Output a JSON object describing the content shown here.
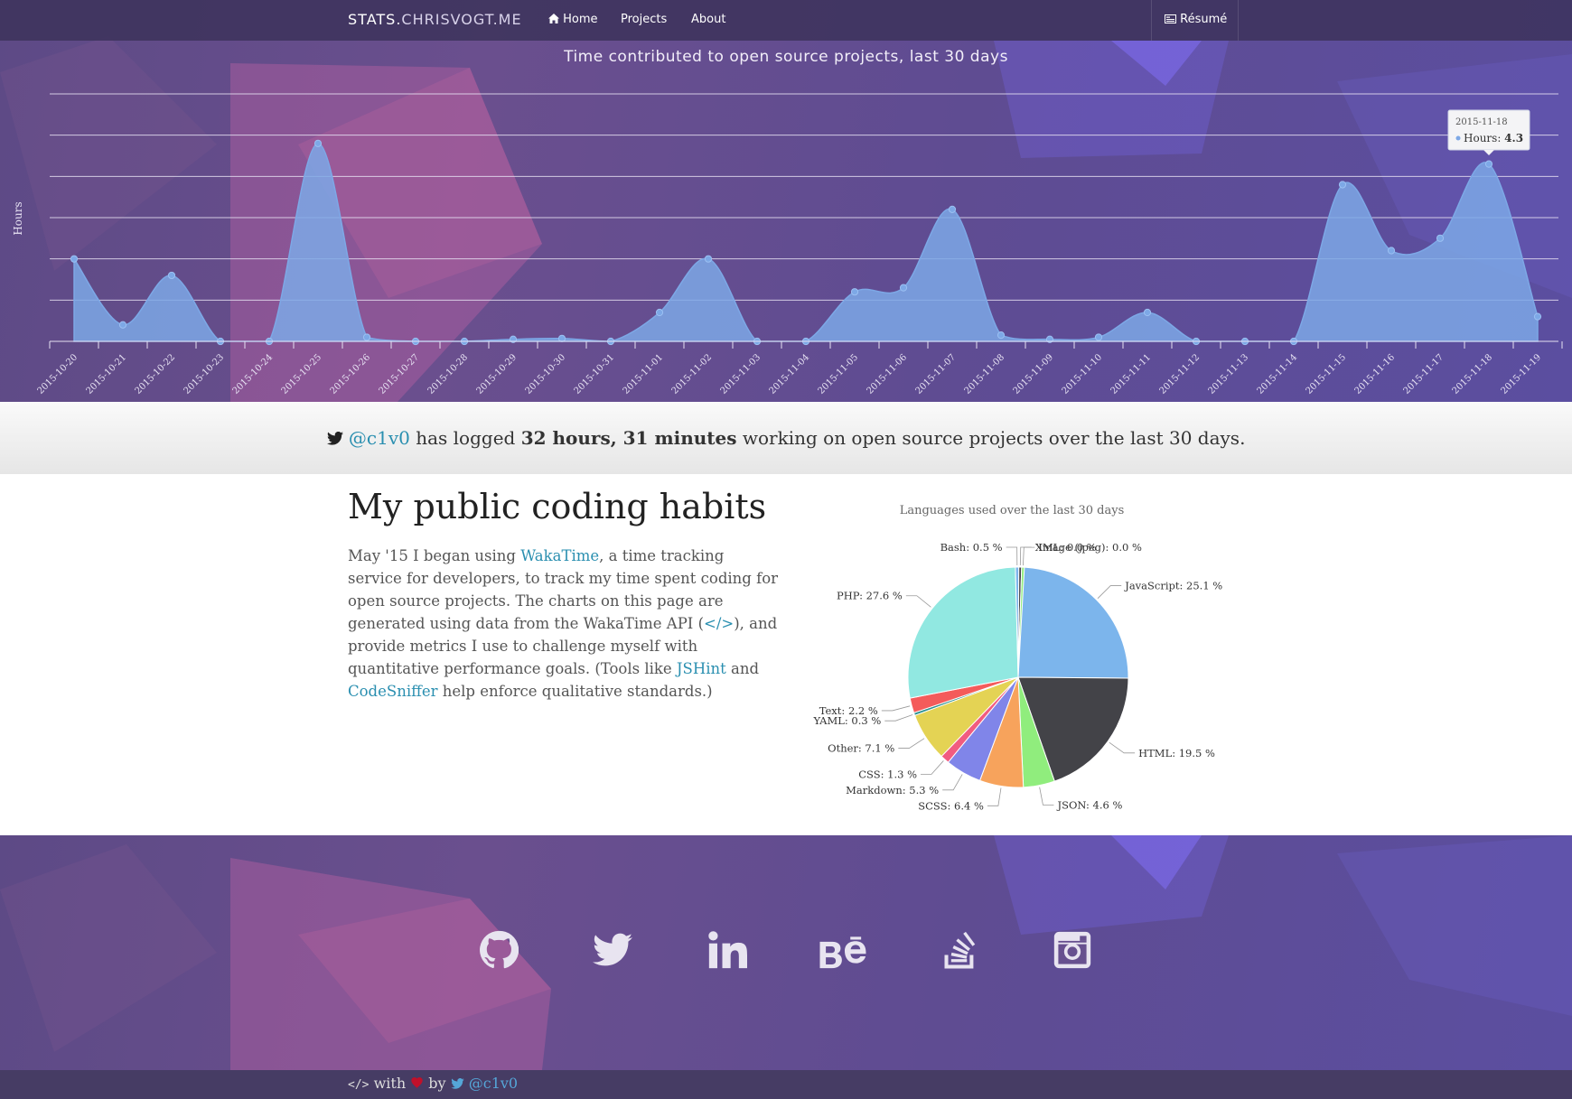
{
  "navbar": {
    "brand_bold": "STATS.",
    "brand_light": "CHRISVOGT.ME",
    "items": [
      {
        "label": "Home",
        "icon": "home-icon"
      },
      {
        "label": "Projects"
      },
      {
        "label": "About"
      }
    ],
    "resume_label": "Résumé",
    "resume_icon": "card-icon"
  },
  "chart_data": [
    {
      "type": "area",
      "title": "Time contributed to open source projects, last 30 days",
      "ylabel": "Hours",
      "x": [
        "2015-10-20",
        "2015-10-21",
        "2015-10-22",
        "2015-10-23",
        "2015-10-24",
        "2015-10-25",
        "2015-10-26",
        "2015-10-27",
        "2015-10-28",
        "2015-10-29",
        "2015-10-30",
        "2015-10-31",
        "2015-11-01",
        "2015-11-02",
        "2015-11-03",
        "2015-11-04",
        "2015-11-05",
        "2015-11-06",
        "2015-11-07",
        "2015-11-08",
        "2015-11-09",
        "2015-11-10",
        "2015-11-11",
        "2015-11-12",
        "2015-11-13",
        "2015-11-14",
        "2015-11-15",
        "2015-11-16",
        "2015-11-17",
        "2015-11-18",
        "2015-11-19"
      ],
      "series": [
        {
          "name": "Hours",
          "values": [
            2.0,
            0.4,
            1.6,
            0.0,
            0.0,
            4.8,
            0.1,
            0.0,
            0.0,
            0.05,
            0.07,
            0.0,
            0.7,
            2.0,
            0.0,
            0.0,
            1.2,
            1.3,
            3.2,
            0.15,
            0.05,
            0.1,
            0.7,
            0.0,
            0.0,
            0.0,
            3.8,
            2.2,
            2.5,
            4.3,
            0.6
          ]
        }
      ],
      "ylim": [
        0,
        6
      ],
      "grid": true,
      "tooltip": {
        "date": "2015-11-18",
        "label": "Hours:",
        "value": "4.3"
      }
    },
    {
      "type": "pie",
      "title": "Languages used over the last 30 days",
      "slices": [
        {
          "name": "JavaScript",
          "value": 25.1,
          "label": "JavaScript: 25.1 %",
          "color": "#7cb5ec"
        },
        {
          "name": "HTML",
          "value": 19.5,
          "label": "HTML: 19.5 %",
          "color": "#434348"
        },
        {
          "name": "JSON",
          "value": 4.6,
          "label": "JSON: 4.6 %",
          "color": "#90ed7d"
        },
        {
          "name": "SCSS",
          "value": 6.4,
          "label": "SCSS: 6.4 %",
          "color": "#f7a35c"
        },
        {
          "name": "Markdown",
          "value": 5.3,
          "label": "Markdown: 5.3 %",
          "color": "#8085e9"
        },
        {
          "name": "CSS",
          "value": 1.3,
          "label": "CSS: 1.3 %",
          "color": "#f15c80"
        },
        {
          "name": "Other",
          "value": 7.1,
          "label": "Other: 7.1 %",
          "color": "#e4d354"
        },
        {
          "name": "YAML",
          "value": 0.3,
          "label": "YAML: 0.3 %",
          "color": "#2b908f"
        },
        {
          "name": "Text",
          "value": 2.2,
          "label": "Text: 2.2 %",
          "color": "#f45b5b"
        },
        {
          "name": "PHP",
          "value": 27.6,
          "label": "PHP: 27.6 %",
          "color": "#91e8e1"
        },
        {
          "name": "Bash",
          "value": 0.5,
          "label": "Bash: 0.5 %",
          "color": "#7cb5ec"
        },
        {
          "name": "XML",
          "value": 0.0,
          "label": "XML: 0.0 %",
          "color": "#434348"
        },
        {
          "name": "Image (jpeg)",
          "value": 0.0,
          "label": "Image (jpeg): 0.0 %",
          "color": "#90ed7d"
        }
      ]
    }
  ],
  "tweet_bar": {
    "icon": "twitter-icon",
    "handle": "@c1v0",
    "text_1": " has logged ",
    "bold": "32 hours, 31 minutes",
    "text_2": " working on open source projects over the last 30 days."
  },
  "habits": {
    "title": "My public coding habits",
    "p1": "May '15 I began using ",
    "link_wakatime": "WakaTime",
    "p2": ", a time tracking service for developers, to track my time spent coding for open source projects. The charts on this page are generated using data from the WakaTime API (",
    "link_api": "</>",
    "p3": "), and provide metrics I use to challenge myself with quantitative performance goals. (Tools like ",
    "link_jshint": "JSHint",
    "p4": " and ",
    "link_codesniffer": "CodeSniffer",
    "p5": " help enforce qualitative standards.)"
  },
  "social": [
    {
      "name": "github-icon"
    },
    {
      "name": "twitter-icon"
    },
    {
      "name": "linkedin-icon"
    },
    {
      "name": "behance-icon"
    },
    {
      "name": "stackoverflow-icon"
    },
    {
      "name": "instagram-icon"
    }
  ],
  "footer": {
    "code": "</>",
    "with": " with ",
    "by": " by ",
    "handle": "@c1v0"
  }
}
